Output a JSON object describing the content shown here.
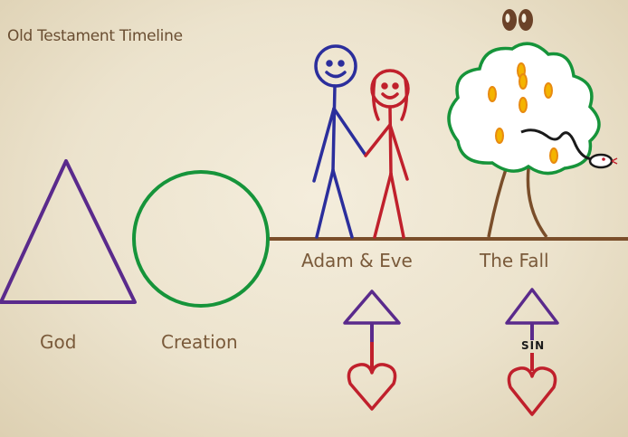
{
  "title": "Old Testament Timeline",
  "labels": {
    "god": "God",
    "creation": "Creation",
    "adam_eve": "Adam & Eve",
    "fall": "The Fall",
    "sin": "SIN"
  },
  "colors": {
    "purple": "#5a2a8c",
    "green": "#16943a",
    "blue": "#2b2e9c",
    "red": "#c0202c",
    "brown": "#7a4e2a",
    "orange": "#f0a020",
    "text": "#7a5a3a"
  },
  "icons": [
    "triangle-god-icon",
    "circle-creation-icon",
    "stick-figure-adam-icon",
    "stick-figure-eve-icon",
    "tree-icon",
    "serpent-icon",
    "eyes-icon",
    "triangle-heart-icon"
  ]
}
